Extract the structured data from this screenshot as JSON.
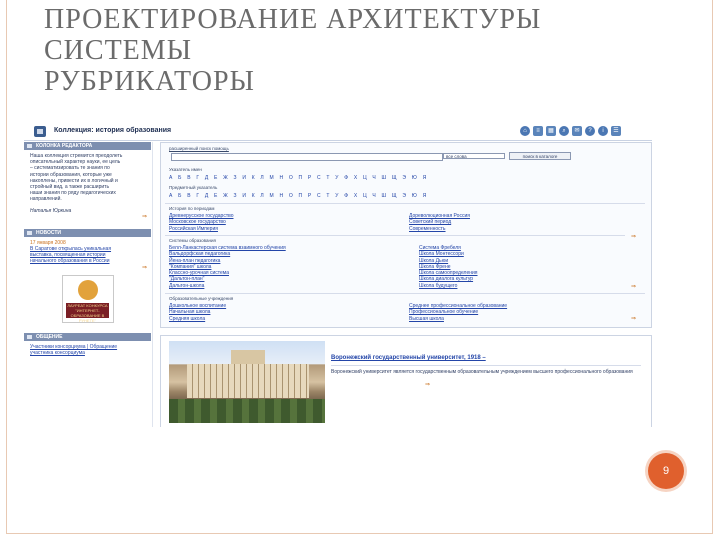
{
  "slide": {
    "title_lines": [
      "ПРОЕКТИРОВАНИЕ АРХИТЕКТУРЫ",
      "СИСТЕМЫ",
      "РУБРИКАТОРЫ"
    ],
    "page_number": "9"
  },
  "screenshot": {
    "header": {
      "collection_title": "Коллекция: история образования"
    },
    "toolbar_icons": [
      "home-icon",
      "list-icon",
      "grid-icon",
      "search-icon",
      "mail-icon",
      "help-icon",
      "info-icon",
      "menu-icon"
    ],
    "left": {
      "editorial": {
        "heading": "КОЛОНКА РЕДАКТОРА",
        "lines": [
          "Наша коллекция стремится преодолеть",
          "описательный характер науки, ее цель",
          "– систематизировать те знания по",
          "истории образования, которые уже",
          "накоплены, привести их в логичный и",
          "стройный вид, а также расширить",
          "наши знания по ряду педагогических",
          "направлений."
        ],
        "author": "Наталья Юркина",
        "more": "⇒"
      },
      "news": {
        "heading": "НОВОСТИ",
        "date": "17 января 2008",
        "lines": [
          "В Саратове открылась уникальная",
          "выставка, посвященная истории",
          "начального образования в России"
        ],
        "more": "⇒",
        "award_label": "ЛАУРЕАТ КОНКУРСА \"ИНТЕРНЕТ-ОБРАЗОВАНИЕ В РУНЕТЕ\""
      },
      "partners": {
        "heading": "ОБЩЕНИЕ",
        "line1": "Участники консорциума | Обращение",
        "line2": "участника консорциума"
      }
    },
    "search": {
      "links": "расширенный поиск   помощь",
      "select_value": "все слова",
      "button": "поиск в каталоге",
      "author_label": "Указатель имен",
      "author_alpha": "А Б В Г Д Е Ж З И К Л М Н О П Р С Т У Ф Х Ц Ч Ш Щ Э Ю Я",
      "subject_label": "Предметный указатель",
      "subject_alpha": "А Б В Г Д Е Ж З И К Л М Н О П Р С Т У Ф Х Ц Ч Ш Щ Э Ю Я",
      "period_label": "История по периодам",
      "period_left": [
        "Древнерусское государство",
        "Московское государство",
        "Российская Империя"
      ],
      "period_right": [
        "Дореволюционная Россия",
        "Советский период",
        "Современность"
      ],
      "systems_label": "Системы образования",
      "systems_left": [
        "Белл-Ланкастерская система взаимного обучения",
        "Вальдорфская педагогика",
        "Йена-план педагогика",
        "\"Компания\" школа",
        "Классно-урочная система",
        "\"Дальтон-план\"",
        "Дальтон-школа"
      ],
      "systems_right": [
        "Система Фребеля",
        "Школа Монтессори",
        "Школа Дьюи",
        "Школа Френе",
        "Школа самоопределения",
        "Школа диалога культур",
        "Школа будущего"
      ],
      "institutions_label": "Образовательные учреждения",
      "institutions_left": [
        "Дошкольное воспитание",
        "Начальная школа",
        "Средняя школа"
      ],
      "institutions_right": [
        "Среднее профессиональное образование",
        "Профессиональное обучение",
        "Высшая школа"
      ],
      "more": "⇒"
    },
    "featured": {
      "title": "Воронежский государственный университет, 1918 –",
      "text": "Воронежский университет является государственным образовательным учреждением высшего профессионального образования",
      "more": "⇒"
    }
  }
}
